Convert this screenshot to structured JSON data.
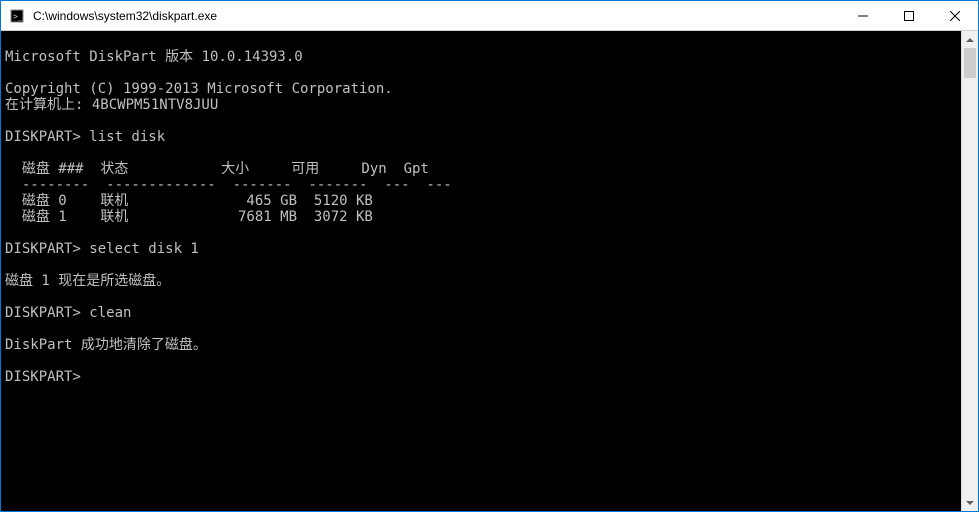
{
  "window": {
    "title": "C:\\windows\\system32\\diskpart.exe"
  },
  "console": {
    "lines": [
      "",
      "Microsoft DiskPart 版本 10.0.14393.0",
      "",
      "Copyright (C) 1999-2013 Microsoft Corporation.",
      "在计算机上: 4BCWPM51NTV8JUU",
      "",
      "DISKPART> list disk",
      "",
      "  磁盘 ###  状态           大小     可用     Dyn  Gpt",
      "  --------  -------------  -------  -------  ---  ---",
      "  磁盘 0    联机              465 GB  5120 KB",
      "  磁盘 1    联机             7681 MB  3072 KB",
      "",
      "DISKPART> select disk 1",
      "",
      "磁盘 1 现在是所选磁盘。",
      "",
      "DISKPART> clean",
      "",
      "DiskPart 成功地清除了磁盘。",
      "",
      "DISKPART>"
    ]
  }
}
